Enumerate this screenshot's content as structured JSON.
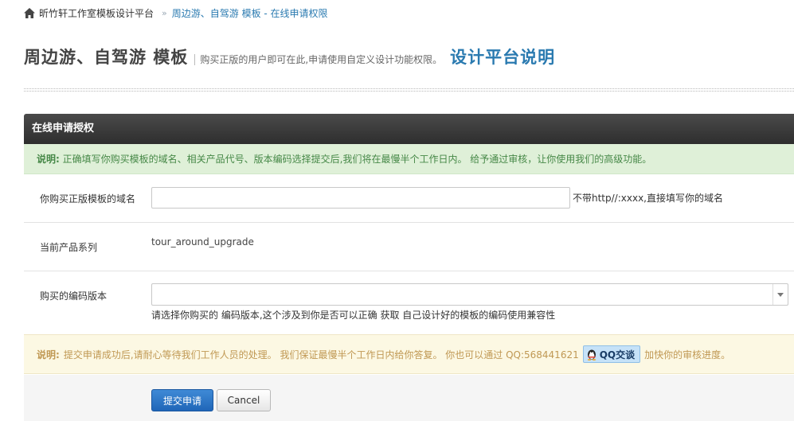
{
  "breadcrumb": {
    "home_label": "昕竹轩工作室模板设计平台",
    "separator": "»",
    "current": "周边游、自驾游 模板 - 在线申请权限"
  },
  "header": {
    "title": "周边游、自驾游 模板",
    "subtitle": "购买正版的用户即可在此,申请使用自定义设计功能权限。",
    "link": "设计平台说明"
  },
  "panel": {
    "title": "在线申请授权"
  },
  "notice_top": {
    "label": "说明:",
    "text": "正确填写你购买模板的域名、相关产品代号、版本编码选择提交后,我们将在最慢半个工作日内。 给予通过审核，让你使用我们的高级功能。"
  },
  "form": {
    "domain_label": "你购买正版模板的域名",
    "domain_value": "",
    "domain_hint": "不带http//:xxxx,直接填写你的域名",
    "product_label": "当前产品系列",
    "product_value": "tour_around_upgrade",
    "version_label": "购买的编码版本",
    "version_selected": "",
    "version_help": "请选择你购买的 编码版本,这个涉及到你是否可以正确 获取 自己设计好的模板的编码使用兼容性"
  },
  "notice_bottom": {
    "label": "说明:",
    "text_before": "提交申请成功后,请耐心等待我们工作人员的处理。 我们保证最慢半个工作日内给你答复。 你也可以通过 QQ:568441621",
    "qq_label": "QQ交谈",
    "text_after": "加快你的审核进度。"
  },
  "buttons": {
    "submit": "提交申请",
    "cancel": "Cancel"
  },
  "colors": {
    "link": "#2a7ab0",
    "success_bg": "#dff0d8",
    "warning_bg": "#fcf8e3",
    "primary": "#2066b8"
  },
  "icons": {
    "home": "home-icon",
    "select_arrow": "caret-down-icon",
    "qq": "qq-penguin-icon"
  }
}
